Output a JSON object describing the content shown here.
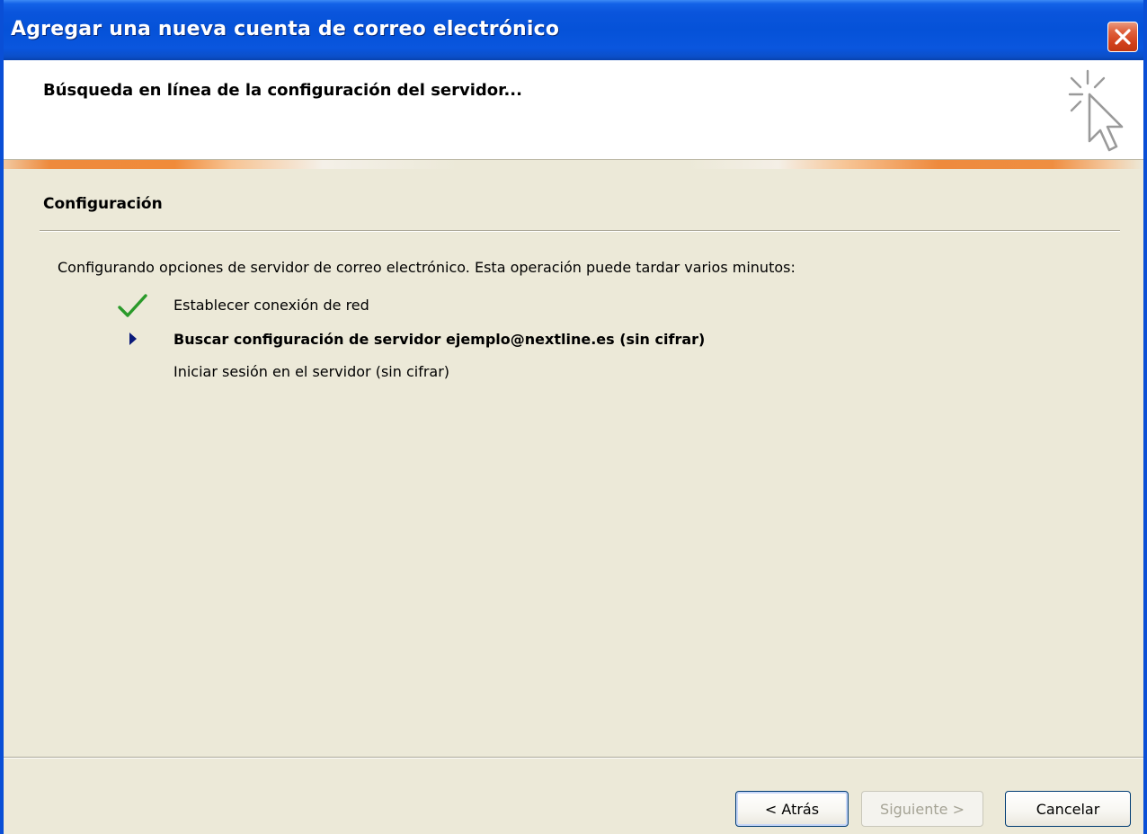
{
  "window": {
    "title": "Agregar una nueva cuenta de correo electrónico",
    "close_icon": "close-icon"
  },
  "header": {
    "title": "Búsqueda en línea de la configuración del servidor...",
    "icon": "cursor-click-icon"
  },
  "section": {
    "title": "Configuración",
    "intro": "Configurando opciones de servidor de correo electrónico. Esta operación puede tardar varios minutos:"
  },
  "steps": [
    {
      "label": "Establecer conexión de red",
      "status": "done",
      "icon": "checkmark-icon"
    },
    {
      "label": "Buscar configuración de servidor ejemplo@nextline.es (sin cifrar)",
      "status": "current",
      "icon": "arrow-right-icon"
    },
    {
      "label": "Iniciar sesión en el servidor (sin cifrar)",
      "status": "pending",
      "icon": ""
    }
  ],
  "buttons": {
    "back": "< Atrás",
    "next": "Siguiente >",
    "cancel": "Cancelar"
  },
  "colors": {
    "titlebar": "#0552d8",
    "accent_orange": "#ee8a3d",
    "check_green": "#2a9a2a",
    "arrow_navy": "#0a1a7a"
  }
}
